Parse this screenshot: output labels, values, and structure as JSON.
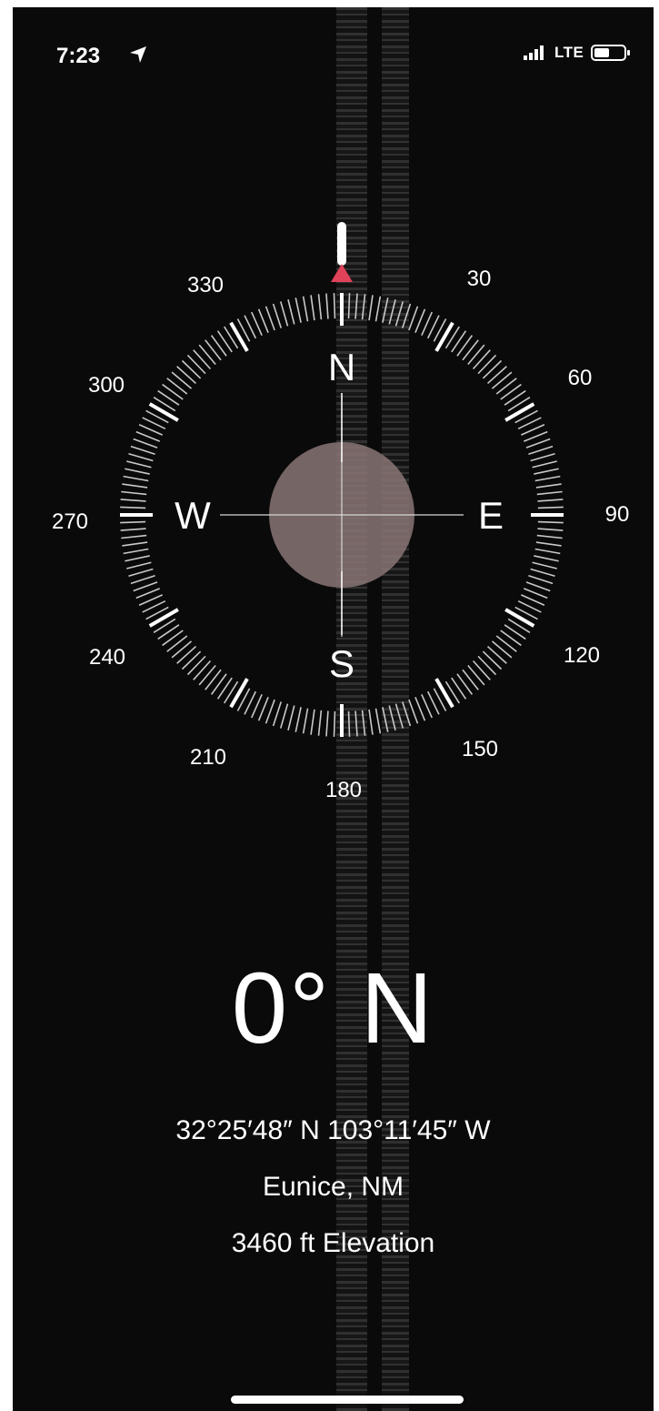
{
  "status_bar": {
    "time": "7:23",
    "network": "LTE",
    "icons": [
      "location-arrow-icon",
      "signal-bars-icon",
      "battery-icon"
    ]
  },
  "compass": {
    "heading_value": "0° N",
    "cardinals": [
      "N",
      "E",
      "S",
      "W"
    ],
    "degree_labels": [
      "30",
      "60",
      "90",
      "120",
      "150",
      "180",
      "210",
      "240",
      "270",
      "300",
      "330"
    ],
    "accent_color": "#e0425a",
    "needle_color": "#ffffff",
    "center_disc_color": "#8a7676"
  },
  "location": {
    "coordinates": "32°25′48″ N  103°11′45″ W",
    "place": "Eunice, NM",
    "elevation": "3460 ft Elevation"
  }
}
